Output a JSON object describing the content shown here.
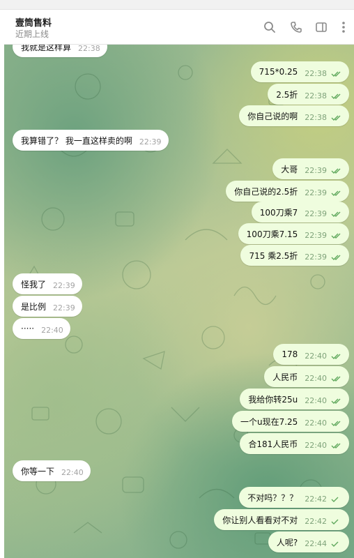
{
  "header": {
    "title": "壹筒售料",
    "subtitle": "近期上线"
  },
  "icons": {
    "search": "search-icon",
    "call": "phone-icon",
    "sidebar": "sidebar-toggle-icon",
    "more": "more-vertical-icon"
  },
  "colors": {
    "outgoing_bubble": "#effdde",
    "incoming_bubble": "#ffffff",
    "tick": "#5fa85c"
  },
  "messages": [
    {
      "dir": "in",
      "text": "我就是这样算",
      "time": "22:38"
    },
    {
      "dir": "out",
      "text": "715*0.25",
      "time": "22:38",
      "ticks": "double"
    },
    {
      "dir": "out",
      "text": "2.5折",
      "time": "22:38",
      "ticks": "double"
    },
    {
      "dir": "out",
      "text": "你自己说的啊",
      "time": "22:38",
      "ticks": "double"
    },
    {
      "dir": "in",
      "text": "我算错了？ 我一直这样卖的啊",
      "time": "22:39"
    },
    {
      "dir": "out",
      "text": "大哥",
      "time": "22:39",
      "ticks": "double"
    },
    {
      "dir": "out",
      "text": "你自己说的2.5折",
      "time": "22:39",
      "ticks": "double"
    },
    {
      "dir": "out",
      "text": "100刀乘7",
      "time": "22:39",
      "ticks": "double"
    },
    {
      "dir": "out",
      "text": "100刀乘7.15",
      "time": "22:39",
      "ticks": "double"
    },
    {
      "dir": "out",
      "text": "715   乘2.5折",
      "time": "22:39",
      "ticks": "double"
    },
    {
      "dir": "in",
      "text": "怪我了",
      "time": "22:39"
    },
    {
      "dir": "in",
      "text": "是比例",
      "time": "22:39"
    },
    {
      "dir": "in",
      "text": "·····",
      "time": "22:40"
    },
    {
      "dir": "out",
      "text": "178",
      "time": "22:40",
      "ticks": "double"
    },
    {
      "dir": "out",
      "text": "人民币",
      "time": "22:40",
      "ticks": "double"
    },
    {
      "dir": "out",
      "text": "我给你转25u",
      "time": "22:40",
      "ticks": "double"
    },
    {
      "dir": "out",
      "text": "一个u现在7.25",
      "time": "22:40",
      "ticks": "double"
    },
    {
      "dir": "out",
      "text": "合181人民币",
      "time": "22:40",
      "ticks": "double"
    },
    {
      "dir": "in",
      "text": "你等一下",
      "time": "22:40"
    },
    {
      "dir": "out",
      "text": "不对吗？？？",
      "time": "22:42",
      "ticks": "single"
    },
    {
      "dir": "out",
      "text": "你让别人看看对不对",
      "time": "22:42",
      "ticks": "single"
    },
    {
      "dir": "out",
      "text": "人呢?",
      "time": "22:44",
      "ticks": "single"
    }
  ]
}
